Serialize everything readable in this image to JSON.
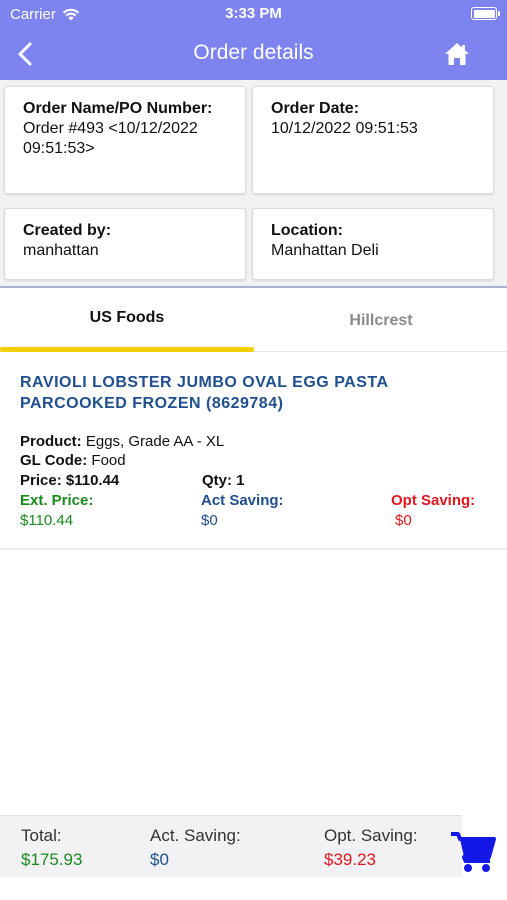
{
  "status_bar": {
    "carrier": "Carrier",
    "time": "3:33 PM"
  },
  "nav": {
    "title": "Order details",
    "back_icon": "chevron-left-icon",
    "home_icon": "home-icon"
  },
  "info": {
    "order_name": {
      "label": "Order Name/PO Number:",
      "value": "Order #493 <10/12/2022 09:51:53>"
    },
    "order_date": {
      "label": "Order Date:",
      "value": "10/12/2022 09:51:53"
    },
    "created_by": {
      "label": "Created by:",
      "value": "manhattan"
    },
    "location": {
      "label": "Location:",
      "value": "Manhattan Deli"
    }
  },
  "tabs": [
    {
      "label": "US Foods",
      "active": true
    },
    {
      "label": "Hillcrest",
      "active": false
    }
  ],
  "item": {
    "title": "RAVIOLI LOBSTER JUMBO OVAL EGG PASTA PARCOOKED FROZEN (8629784)",
    "product_label": "Product:",
    "product_value": "Eggs, Grade AA - XL",
    "gl_label": "GL Code:",
    "gl_value": "Food",
    "price_label": "Price:",
    "price_value": "$110.44",
    "qty_label": "Qty:",
    "qty_value": "1",
    "ext_price_label": "Ext. Price:",
    "ext_price_value": "$110.44",
    "act_saving_label": "Act Saving:",
    "act_saving_value": "$0",
    "opt_saving_label": "Opt Saving:",
    "opt_saving_value": "$0"
  },
  "footer": {
    "total_label": "Total:",
    "total_value": "$175.93",
    "act_label": "Act. Saving:",
    "act_value": "$0",
    "opt_label": "Opt. Saving:",
    "opt_value": "$39.23",
    "cart_icon": "cart-icon"
  },
  "colors": {
    "header": "#7d84f0",
    "tab_underline": "#f5d000",
    "item_title": "#1f4f8f",
    "green": "#1a8a1f",
    "blue": "#1f4f8f",
    "red": "#e0171f",
    "cart": "#1418e6"
  }
}
